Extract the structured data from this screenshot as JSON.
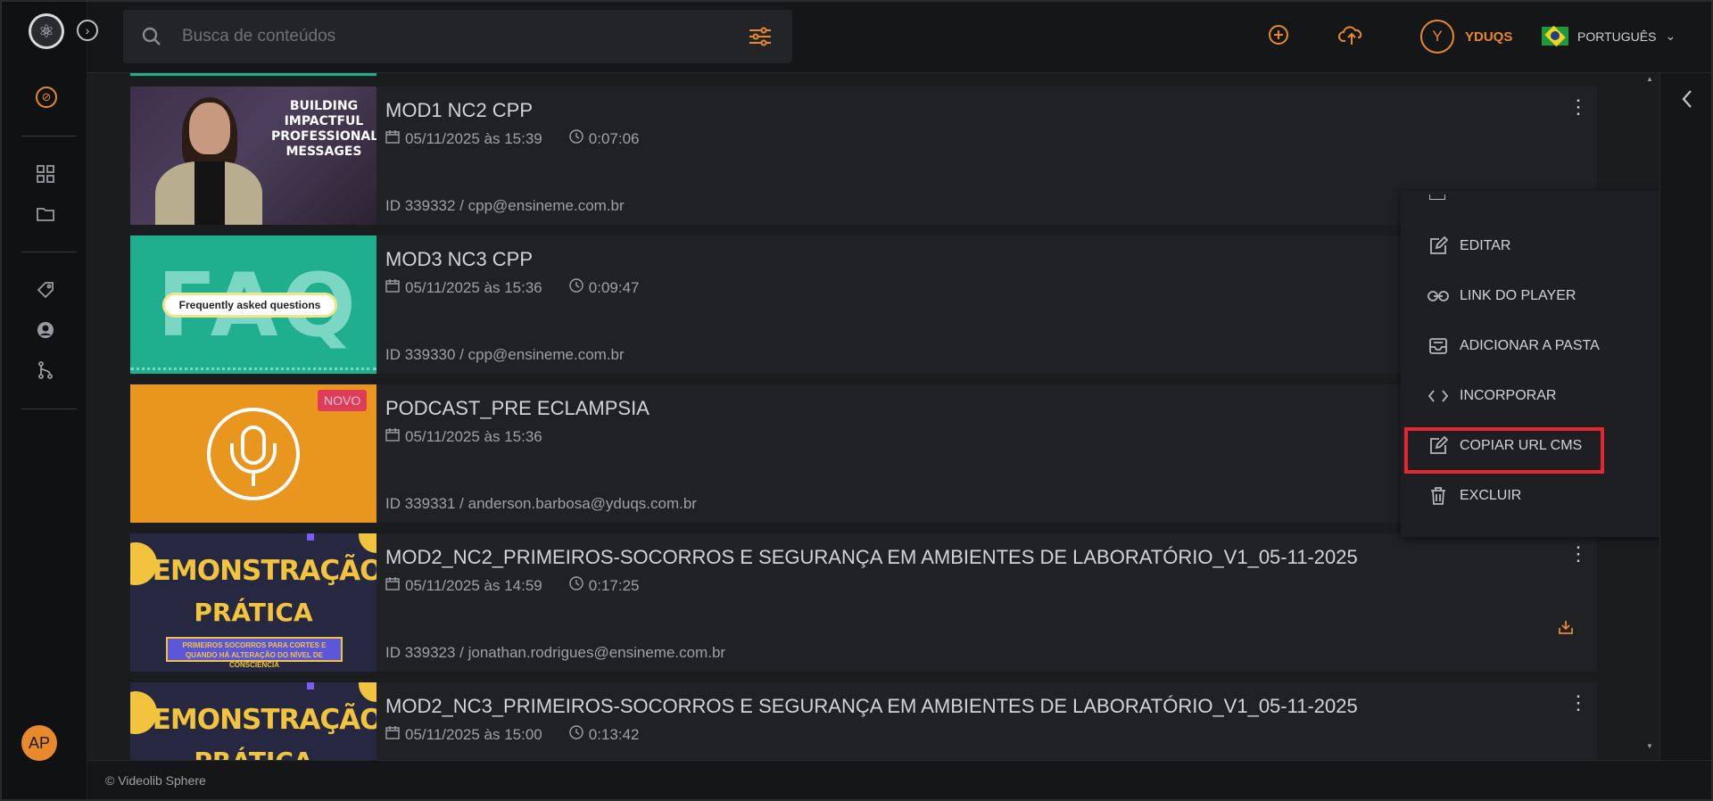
{
  "header": {
    "search_placeholder": "Busca de conteúdos",
    "user_initial": "Y",
    "user_name": "YDUQS",
    "language": "PORTUGUÊS"
  },
  "sidebar": {
    "logo": "atom-icon",
    "avatar_initials": "AP",
    "items": [
      "brand-icon",
      "grid-icon",
      "folder-icon",
      "tag-icon",
      "user-icon",
      "branch-icon"
    ]
  },
  "rows": [
    {
      "title": "MOD1 NC2 CPP",
      "date": "05/11/2025 às 15:39",
      "duration": "0:07:06",
      "id_line": "ID 339332 / cpp@ensineme.com.br",
      "thumb_text": "BUILDING IMPACTFUL PROFESSIONAL MESSAGES"
    },
    {
      "title": "MOD3 NC3 CPP",
      "date": "05/11/2025 às 15:36",
      "duration": "0:09:47",
      "id_line": "ID 339330 / cpp@ensineme.com.br",
      "thumb_big": "FAQ",
      "thumb_pill": "Frequently asked questions"
    },
    {
      "title": "PODCAST_PRE ECLAMPSIA",
      "date": "05/11/2025 às 15:36",
      "badge": "NOVO",
      "id_line": "ID 339331 / anderson.barbosa@yduqs.com.br"
    },
    {
      "title": "MOD2_NC2_PRIMEIROS-SOCORROS E SEGURANÇA EM AMBIENTES DE LABORATÓRIO_V1_05-11-2025",
      "date": "05/11/2025 às 14:59",
      "duration": "0:17:25",
      "id_line": "ID 339323 / jonathan.rodrigues@ensineme.com.br",
      "thumb_line1": "DEMONSTRAÇÃO",
      "thumb_line2": "PRÁTICA",
      "thumb_box": "PRIMEIROS SOCORROS PARA CORTES E QUANDO HÁ ALTERAÇÃO DO NÍVEL DE CONSCIÊNCIA"
    },
    {
      "title": "MOD2_NC3_PRIMEIROS-SOCORROS E SEGURANÇA EM AMBIENTES DE LABORATÓRIO_V1_05-11-2025",
      "date": "05/11/2025 às 15:00",
      "duration": "0:13:42",
      "thumb_line1": "DEMONSTRAÇÃO",
      "thumb_line2": "PRÁTICA"
    }
  ],
  "menu": {
    "items": [
      "EDITAR",
      "LINK DO PLAYER",
      "ADICIONAR A PASTA",
      "INCORPORAR",
      "COPIAR URL CMS",
      "EXCLUIR"
    ],
    "highlighted": "COPIAR URL CMS"
  },
  "footer": {
    "text": "© Videolib Sphere"
  },
  "colors": {
    "accent": "#e8892b",
    "highlight": "#e3262f",
    "badge": "#e03c5a"
  }
}
